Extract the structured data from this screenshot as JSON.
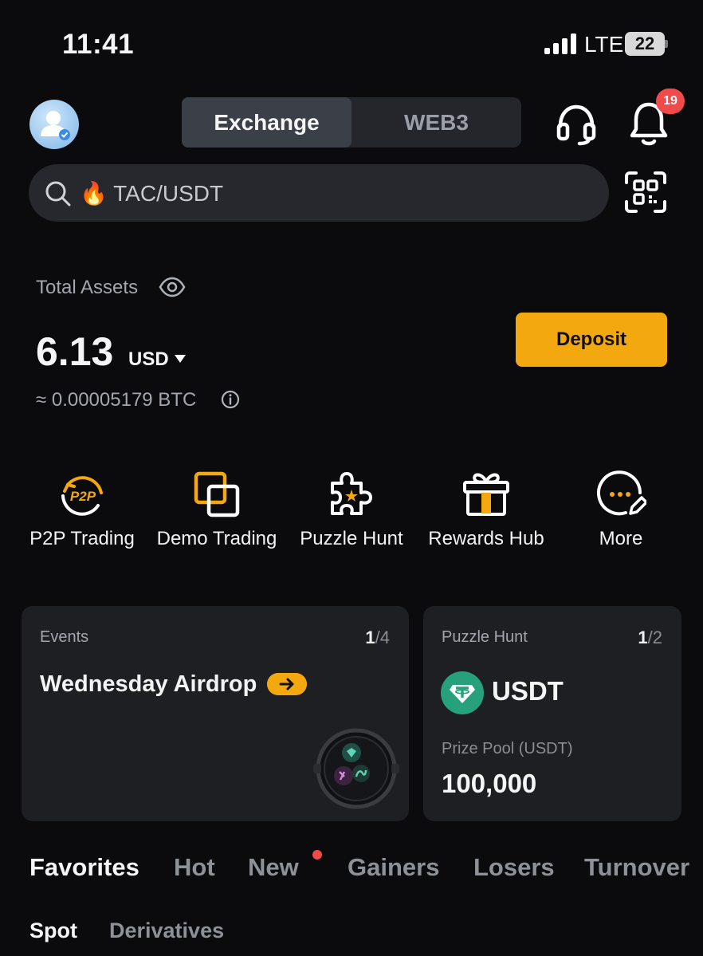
{
  "status_bar": {
    "time": "11:41",
    "network": "LTE",
    "battery": "22"
  },
  "header": {
    "tabs": [
      {
        "label": "Exchange",
        "active": true
      },
      {
        "label": "WEB3",
        "active": false
      }
    ],
    "notification_count": "19"
  },
  "search": {
    "emoji": "🔥",
    "text": "TAC/USDT"
  },
  "assets": {
    "label": "Total Assets",
    "amount": "6.13",
    "currency": "USD",
    "btc_equivalent": "≈ 0.00005179 BTC",
    "deposit_label": "Deposit"
  },
  "quick_actions": [
    {
      "label": "P2P Trading",
      "icon": "p2p-icon"
    },
    {
      "label": "Demo Trading",
      "icon": "demo-trading-icon"
    },
    {
      "label": "Puzzle Hunt",
      "icon": "puzzle-icon"
    },
    {
      "label": "Rewards Hub",
      "icon": "gift-icon"
    },
    {
      "label": "More",
      "icon": "more-icon"
    }
  ],
  "cards": {
    "events": {
      "label": "Events",
      "page_current": "1",
      "page_total": "/4",
      "title": "Wednesday Airdrop"
    },
    "puzzle": {
      "label": "Puzzle Hunt",
      "page_current": "1",
      "page_total": "/2",
      "token": "USDT",
      "prize_label": "Prize Pool (USDT)",
      "prize_value": "100,000"
    }
  },
  "market_tabs": [
    {
      "label": "Favorites",
      "active": true
    },
    {
      "label": "Hot",
      "active": false
    },
    {
      "label": "New",
      "active": false
    },
    {
      "label": "Gainers",
      "active": false
    },
    {
      "label": "Losers",
      "active": false
    },
    {
      "label": "Turnover",
      "active": false
    }
  ],
  "sub_tabs": [
    {
      "label": "Spot",
      "active": true
    },
    {
      "label": "Derivatives",
      "active": false
    }
  ],
  "colors": {
    "accent": "#f4a80f",
    "background": "#0b0b0e",
    "card": "#1d1f23",
    "badge": "#f04a4a",
    "tether": "#26a17b"
  }
}
